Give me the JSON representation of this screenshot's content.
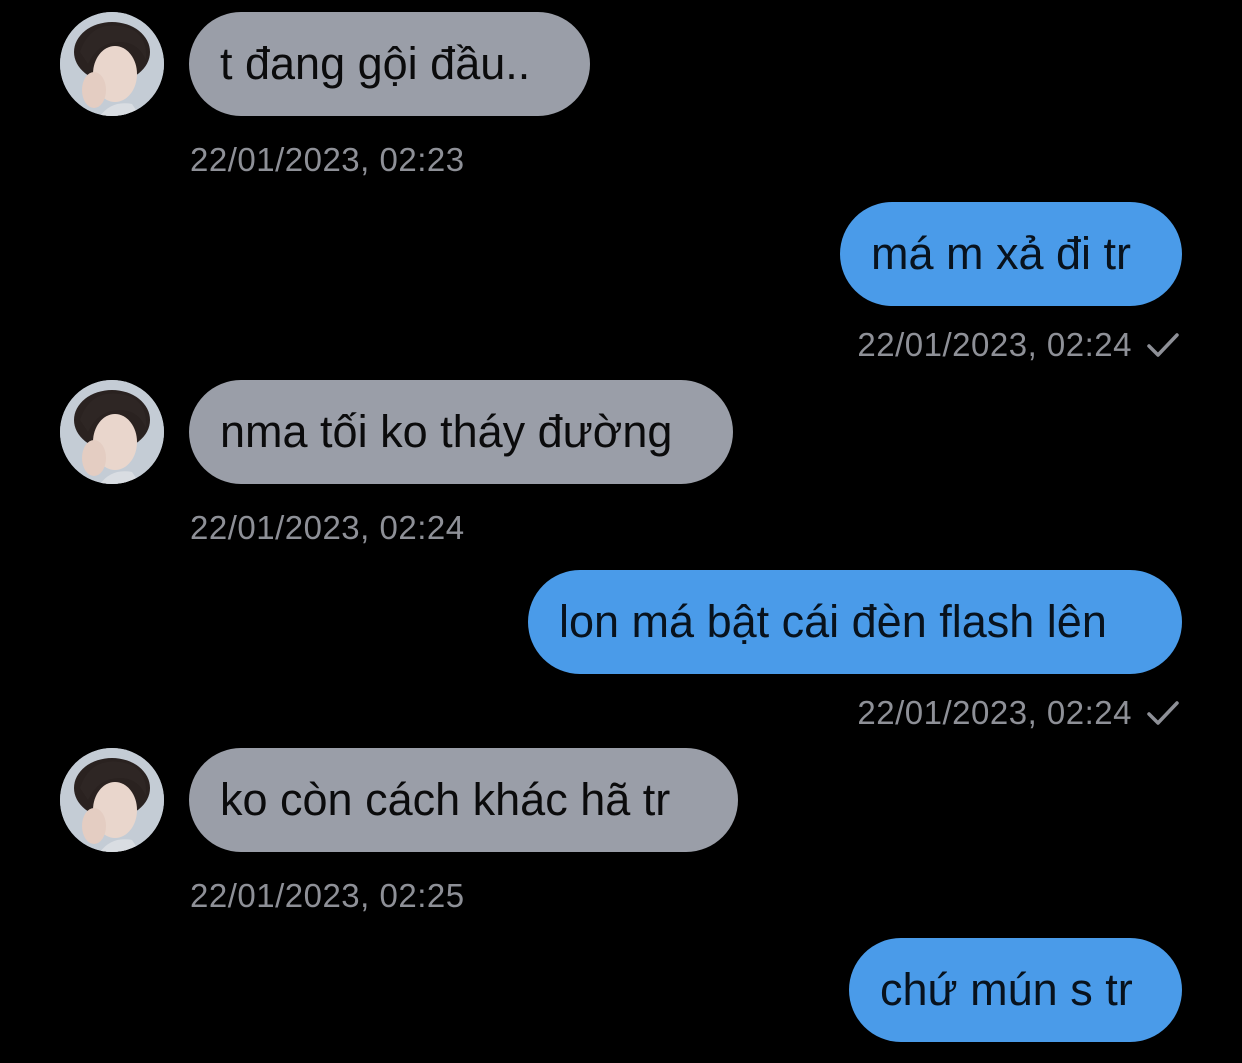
{
  "conversation": {
    "messages": [
      {
        "text": "t đang gội đầu..",
        "time": "22/01/2023, 02:23"
      },
      {
        "text": "má m xả đi tr",
        "time": "22/01/2023, 02:24"
      },
      {
        "text": "nma tối ko tháy đường",
        "time": "22/01/2023, 02:24"
      },
      {
        "text": "lon má bật cái đèn flash lên",
        "time": "22/01/2023, 02:24"
      },
      {
        "text": "ko còn cách khác hã tr",
        "time": "22/01/2023, 02:25"
      },
      {
        "text": "chứ mún s tr"
      }
    ]
  },
  "colors": {
    "background": "#000000",
    "incoming_bubble": "#9a9ea8",
    "outgoing_bubble": "#4a9be9",
    "timestamp": "#8e9097"
  },
  "icons": {
    "avatar": "profile-photo",
    "sent_indicator": "check-icon"
  }
}
